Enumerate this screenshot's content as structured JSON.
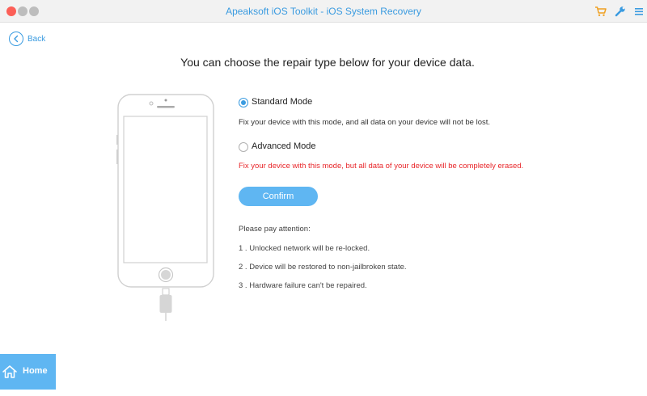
{
  "window": {
    "title": "Apeaksoft iOS Toolkit - iOS System Recovery"
  },
  "toolbar": {
    "cart_icon": "cart-icon",
    "wrench_icon": "wrench-icon",
    "menu_icon": "menu-icon"
  },
  "nav": {
    "back_label": "Back",
    "home_label": "Home"
  },
  "heading": "You can choose the repair type below for your device data.",
  "options": [
    {
      "label": "Standard Mode",
      "selected": true,
      "description": "Fix your device with this mode, and all data on your device will not be lost."
    },
    {
      "label": "Advanced Mode",
      "selected": false,
      "description": "Fix your device with this mode, but all data of your device will be completely erased."
    }
  ],
  "confirm_label": "Confirm",
  "attention": {
    "title": "Please pay attention:",
    "items": [
      "1 . Unlocked network will be re-locked.",
      "2 . Device will be restored to non-jailbroken state.",
      "3 . Hardware failure can't be repaired."
    ]
  },
  "colors": {
    "accent": "#3a9be0",
    "button": "#5fb6f2",
    "warning": "#e8262a"
  }
}
